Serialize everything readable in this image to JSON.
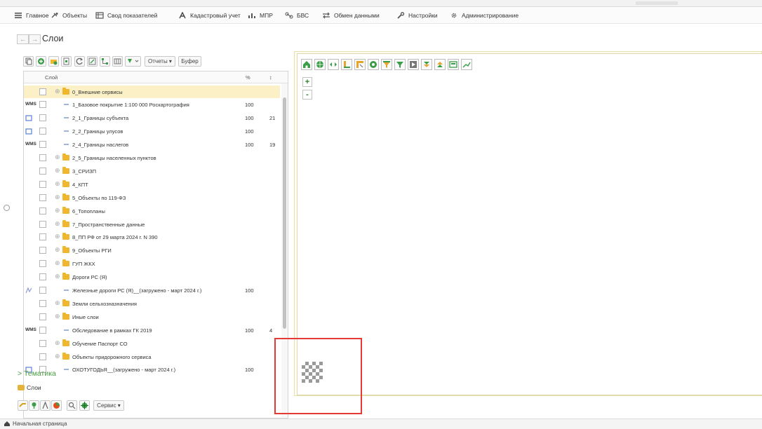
{
  "menu": {
    "items": [
      {
        "label": "Главное",
        "icon": "hamburger-icon"
      },
      {
        "label": "Объекты",
        "icon": "tools-icon"
      },
      {
        "label": "Свод показателей",
        "icon": "table-icon"
      },
      {
        "label": "Кадастровый учет",
        "icon": "letter-a-icon"
      },
      {
        "label": "МПР",
        "icon": "chart-icon"
      },
      {
        "label": "БВС",
        "icon": "drone-icon"
      },
      {
        "label": "Обмен данными",
        "icon": "exchange-icon"
      },
      {
        "label": "Настройки",
        "icon": "wrench-icon"
      },
      {
        "label": "Администрирование",
        "icon": "gear-icon"
      }
    ]
  },
  "nav": {
    "back": "←",
    "forward": "→",
    "title": "Слои"
  },
  "toolbar": {
    "reports": "Отчеты ▾",
    "buffer": "Буфер"
  },
  "grid": {
    "headers": {
      "layer": "Слой",
      "percent": "%",
      "order": "↕"
    },
    "rows": [
      {
        "type": "folder",
        "label": "0_Внешние сервисы",
        "percent": "",
        "order": "",
        "marker": "",
        "selected": true
      },
      {
        "type": "layer",
        "label": "1_Базовое покрытие 1:100 000 Роскартография",
        "percent": "100",
        "order": "",
        "marker": "WMS"
      },
      {
        "type": "layer",
        "label": "2_1_Границы субъекта",
        "percent": "100",
        "order": "21",
        "marker": "poly"
      },
      {
        "type": "layer",
        "label": "2_2_Границы улусов",
        "percent": "100",
        "order": "",
        "marker": "poly"
      },
      {
        "type": "layer",
        "label": "2_4_Границы наслегов",
        "percent": "100",
        "order": "19",
        "marker": "WMS"
      },
      {
        "type": "folder",
        "label": "2_5_Границы населенных пунктов",
        "percent": "",
        "order": "",
        "marker": ""
      },
      {
        "type": "folder",
        "label": "3_СРИЗП",
        "percent": "",
        "order": "",
        "marker": ""
      },
      {
        "type": "folder",
        "label": "4_КПТ",
        "percent": "",
        "order": "",
        "marker": ""
      },
      {
        "type": "folder",
        "label": "5_Объекты по 119-ФЗ",
        "percent": "",
        "order": "",
        "marker": ""
      },
      {
        "type": "folder",
        "label": "6_Топопланы",
        "percent": "",
        "order": "",
        "marker": ""
      },
      {
        "type": "folder",
        "label": "7_Пространственные данные",
        "percent": "",
        "order": "",
        "marker": ""
      },
      {
        "type": "folder",
        "label": "8_ПП РФ от 29 марта 2024 г. N 390",
        "percent": "",
        "order": "",
        "marker": ""
      },
      {
        "type": "folder",
        "label": "9_Объекты РГИ",
        "percent": "",
        "order": "",
        "marker": ""
      },
      {
        "type": "folder",
        "label": "ГУП ЖКХ",
        "percent": "",
        "order": "",
        "marker": ""
      },
      {
        "type": "folder",
        "label": "Дороги РС (Я)",
        "percent": "",
        "order": "",
        "marker": ""
      },
      {
        "type": "layer",
        "label": "Железные дороги РС (Я)__(загружено - март 2024 г.)",
        "percent": "100",
        "order": "",
        "marker": "line"
      },
      {
        "type": "folder",
        "label": "Земли сельхозназначения",
        "percent": "",
        "order": "",
        "marker": ""
      },
      {
        "type": "folder",
        "label": "Иные слои",
        "percent": "",
        "order": "",
        "marker": ""
      },
      {
        "type": "layer",
        "label": "Обследование в рамках ГК 2019",
        "percent": "100",
        "order": "4",
        "marker": "WMS"
      },
      {
        "type": "folder",
        "label": "Обучение Паспорт СО",
        "percent": "",
        "order": "",
        "marker": ""
      },
      {
        "type": "folder",
        "label": "Объекты придорожного сервиса",
        "percent": "",
        "order": "",
        "marker": ""
      },
      {
        "type": "layer",
        "label": "ОХОТУГОДЬЯ__(загружено - март 2024 г.)",
        "percent": "100",
        "order": "",
        "marker": "poly"
      }
    ]
  },
  "thematic": {
    "label": "> Тематика"
  },
  "tabs": {
    "layers": "Слои"
  },
  "bottom_toolbar": {
    "service": "Сервис ▾"
  },
  "map": {
    "zoom_in": "+",
    "zoom_out": "-"
  },
  "status": {
    "home_tab": "Начальная страница"
  },
  "colors": {
    "accent_green": "#4a9b45",
    "selection": "#fbf0c6",
    "highlight_box": "#e53935",
    "wms": "#333333",
    "poly": "#5c7fd1",
    "line": "#8e9ed6"
  }
}
